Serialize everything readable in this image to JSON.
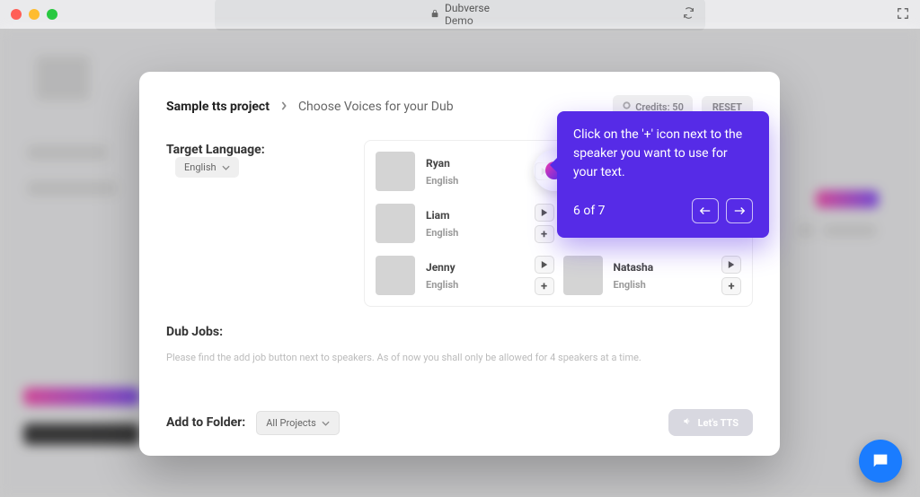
{
  "chrome": {
    "title": "Dubverse Demo"
  },
  "breadcrumb": {
    "current": "Sample tts project",
    "next": "Choose Voices for your Dub"
  },
  "header_buttons": {
    "credits": "Credits: 50",
    "reset": "RESET"
  },
  "target_language": {
    "label": "Target Language:",
    "value": "English"
  },
  "voices": [
    {
      "name": "Ryan",
      "lang": "English",
      "show_add": false
    },
    {
      "name": "",
      "lang": "",
      "show_add": false
    },
    {
      "name": "Liam",
      "lang": "English",
      "show_add": true
    },
    {
      "name": "",
      "lang": "",
      "show_add": true
    },
    {
      "name": "Jenny",
      "lang": "English",
      "show_add": true
    },
    {
      "name": "Natasha",
      "lang": "English",
      "show_add": true
    }
  ],
  "dub_jobs": {
    "title": "Dub Jobs:",
    "hint": "Please find the add job button next to speakers. As of now you shall only be allowed for 4 speakers at a time."
  },
  "folder": {
    "label": "Add to Folder:",
    "value": "All Projects"
  },
  "cta": {
    "lets_tts": "Let's TTS"
  },
  "tour": {
    "text": "Click on the '+' icon next to the speaker you want to use for your text.",
    "step": "6 of 7"
  }
}
